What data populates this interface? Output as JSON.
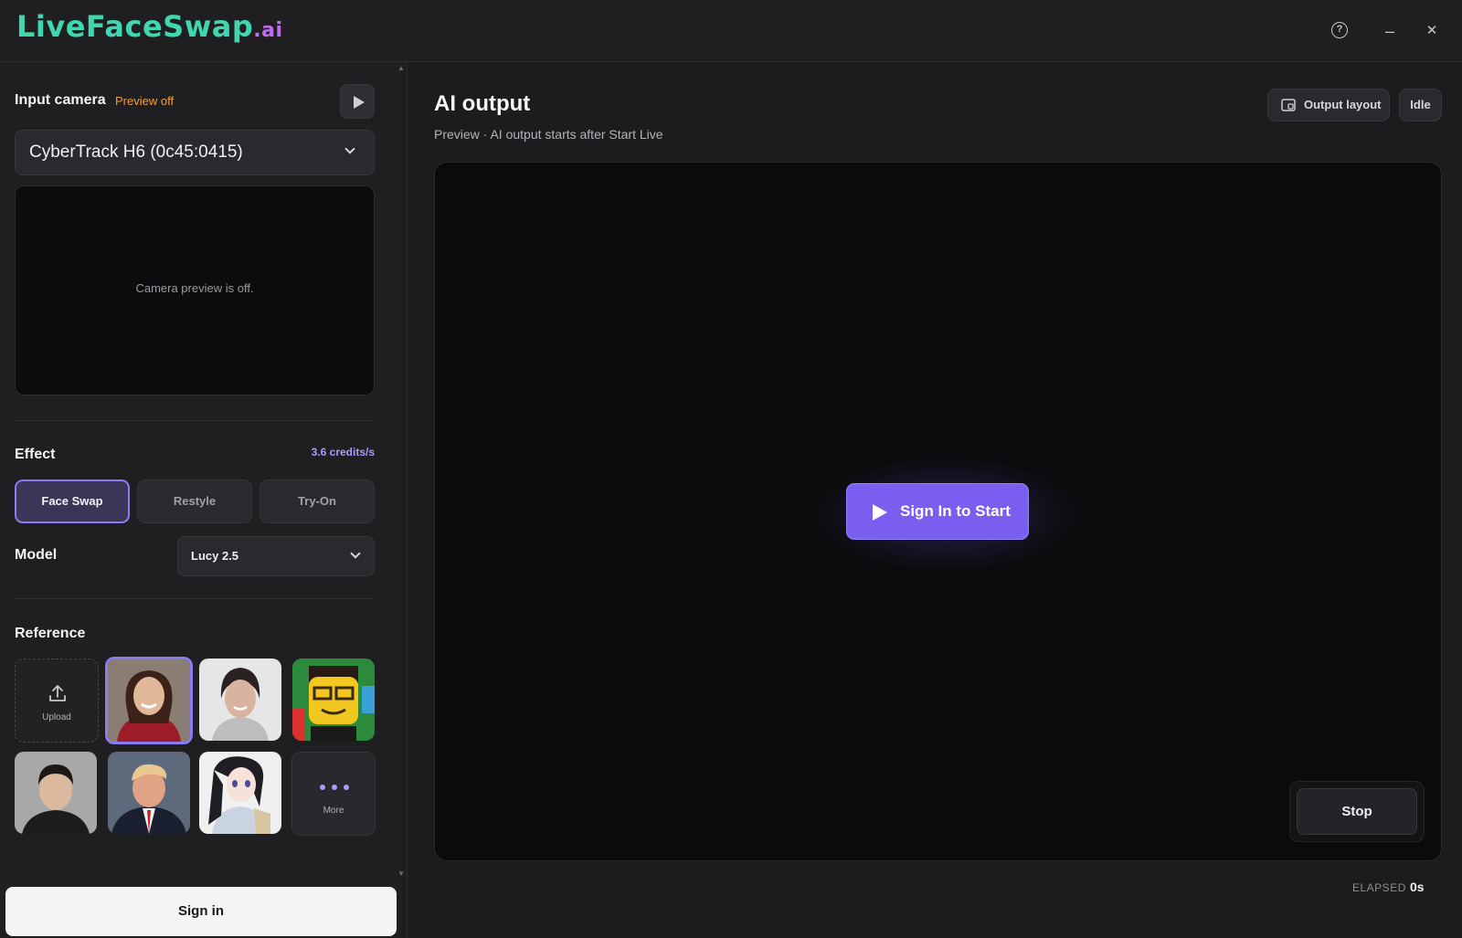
{
  "app": {
    "logo_main": "LiveFaceSwap",
    "logo_suffix": ".ai"
  },
  "window_controls": {
    "help": "?",
    "minimize": "–",
    "close": "✕"
  },
  "input_camera": {
    "title": "Input camera",
    "status": "Preview off",
    "selected_camera": "CyberTrack H6 (0c45:0415)",
    "preview_message": "Camera preview is off."
  },
  "effect": {
    "title": "Effect",
    "credits": "3.6 credits/s",
    "options": [
      {
        "label": "Face Swap",
        "active": true
      },
      {
        "label": "Restyle",
        "active": false
      },
      {
        "label": "Try-On",
        "active": false
      }
    ]
  },
  "model": {
    "title": "Model",
    "selected": "Lucy 2.5"
  },
  "reference": {
    "title": "Reference",
    "upload_label": "Upload",
    "more_label": "More"
  },
  "footer": {
    "sign_in": "Sign in"
  },
  "output": {
    "title": "AI output",
    "subtitle": "Preview · AI output starts after Start Live",
    "layout_button": "Output layout",
    "status": "Idle",
    "start_button": "Sign In to Start",
    "stop_button": "Stop",
    "elapsed_label": "ELAPSED",
    "elapsed_value": "0s"
  },
  "colors": {
    "accent": "#7a5ef0",
    "logo": "#3fd6b0",
    "logo_suffix": "#c06cf0",
    "preview_status": "#f0a040",
    "credits": "#a99bff"
  }
}
